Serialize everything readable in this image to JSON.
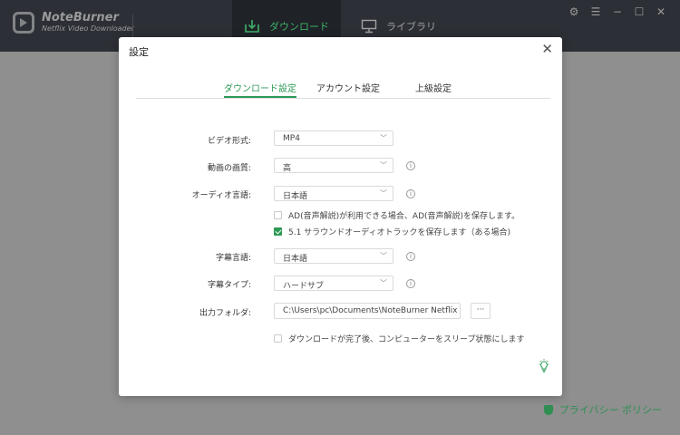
{
  "app": {
    "brand_title": "NoteBurner",
    "brand_subtitle": "Netflix Video Downloader",
    "nav": [
      {
        "label": "ダウンロード",
        "icon": "download-icon",
        "active": true
      },
      {
        "label": "ライブラリ",
        "icon": "library-icon",
        "active": false
      }
    ],
    "window_controls": [
      "gear-icon",
      "menu-icon",
      "minimize-icon",
      "maximize-icon",
      "close-icon"
    ],
    "privacy_label": "プライバシー ポリシー"
  },
  "dialog": {
    "title": "設定",
    "close_symbol": "✕",
    "tabs": [
      {
        "label": "ダウンロード設定",
        "active": true
      },
      {
        "label": "アカウント設定",
        "active": false
      },
      {
        "label": "上級設定",
        "active": false
      }
    ],
    "fields": {
      "video_format": {
        "label": "ビデオ形式:",
        "value": "MP4"
      },
      "quality": {
        "label": "動画の画質:",
        "value": "高"
      },
      "audio_language": {
        "label": "オーディオ言語:",
        "value": "日本語"
      },
      "subtitle_language": {
        "label": "字幕言語:",
        "value": "日本語"
      },
      "subtitle_type": {
        "label": "字幕タイプ:",
        "value": "ハードサブ"
      },
      "output_folder": {
        "label": "出力フォルダ:",
        "value": "C:\\Users\\pc\\Documents\\NoteBurner Netflix V",
        "browse_label": "···"
      }
    },
    "options": {
      "audio_description": {
        "label": "AD(音声解説)が利用できる場合、AD(音声解説)を保存します。",
        "checked": false
      },
      "surround": {
        "label": "5.1 サラウンドオーディオトラックを保存します（ある場合)",
        "checked": true
      },
      "sleep_after": {
        "label": "ダウンロードが完了後、コンピューターをスリープ状態にします",
        "checked": false
      }
    },
    "info_symbol": "i",
    "chevron_symbol": "﹀"
  },
  "colors": {
    "accent": "#2d9a56",
    "header_bg": "#2c2f35",
    "overlay_bg": "#8f8f8f"
  }
}
